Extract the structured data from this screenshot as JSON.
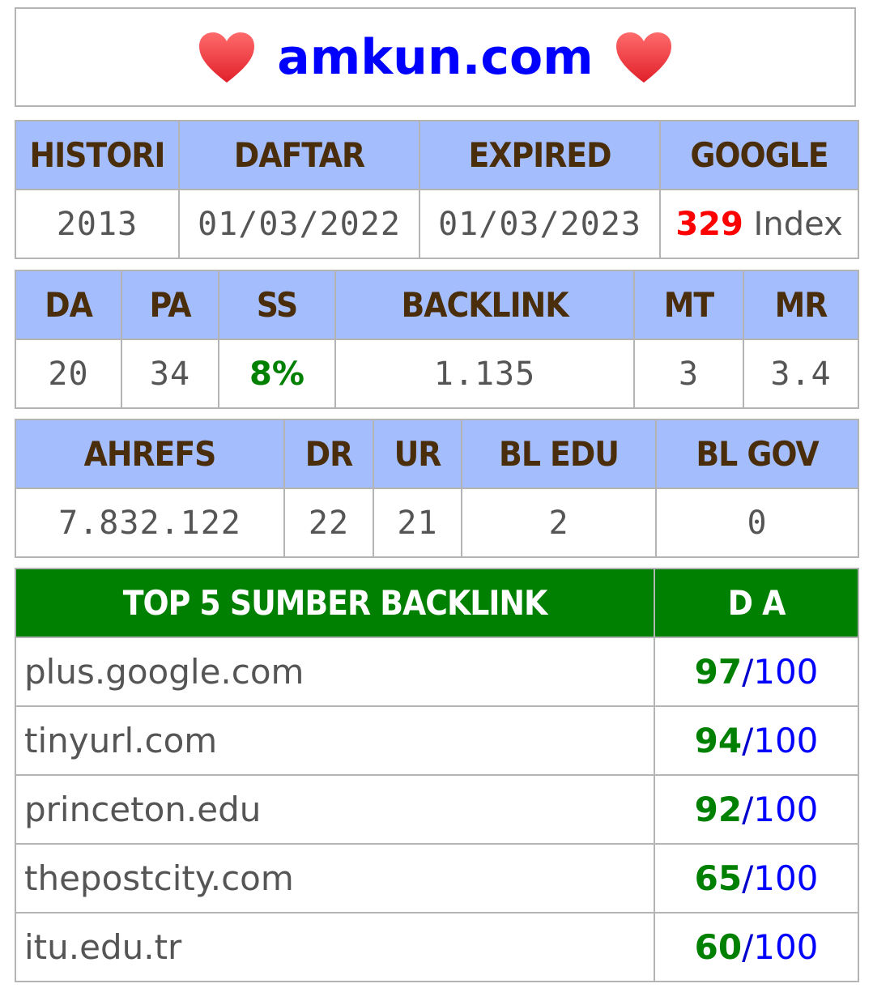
{
  "header": {
    "domain": "amkun.com",
    "heart_icon_color": "#ff3b3b"
  },
  "info": {
    "headers": [
      "HISTORI",
      "DAFTAR",
      "EXPIRED",
      "GOOGLE"
    ],
    "histori": "2013",
    "daftar": "01/03/2022",
    "expired": "01/03/2023",
    "google_count": "329",
    "google_suffix": " Index"
  },
  "moz": {
    "headers": [
      "DA",
      "PA",
      "SS",
      "BACKLINK",
      "MT",
      "MR"
    ],
    "values": [
      "20",
      "34",
      "8%",
      "1.135",
      "3",
      "3.4"
    ]
  },
  "ahrefs": {
    "headers": [
      "AHREFS",
      "DR",
      "UR",
      "BL EDU",
      "BL GOV"
    ],
    "values": [
      "7.832.122",
      "22",
      "21",
      "2",
      "0"
    ]
  },
  "top_backlinks": {
    "headers": [
      "TOP 5 SUMBER BACKLINK",
      "D A"
    ],
    "max": "100",
    "separator": "/",
    "rows": [
      {
        "site": "plus.google.com",
        "da": "97"
      },
      {
        "site": "tinyurl.com",
        "da": "94"
      },
      {
        "site": "princeton.edu",
        "da": "92"
      },
      {
        "site": "thepostcity.com",
        "da": "65"
      },
      {
        "site": "itu.edu.tr",
        "da": "60"
      }
    ]
  },
  "colors": {
    "header_bg": "#a4bdfc",
    "header_text": "#4a2d0b",
    "green_header_bg": "#008000",
    "domain_blue": "#0000ff",
    "index_red": "#ff0000"
  }
}
